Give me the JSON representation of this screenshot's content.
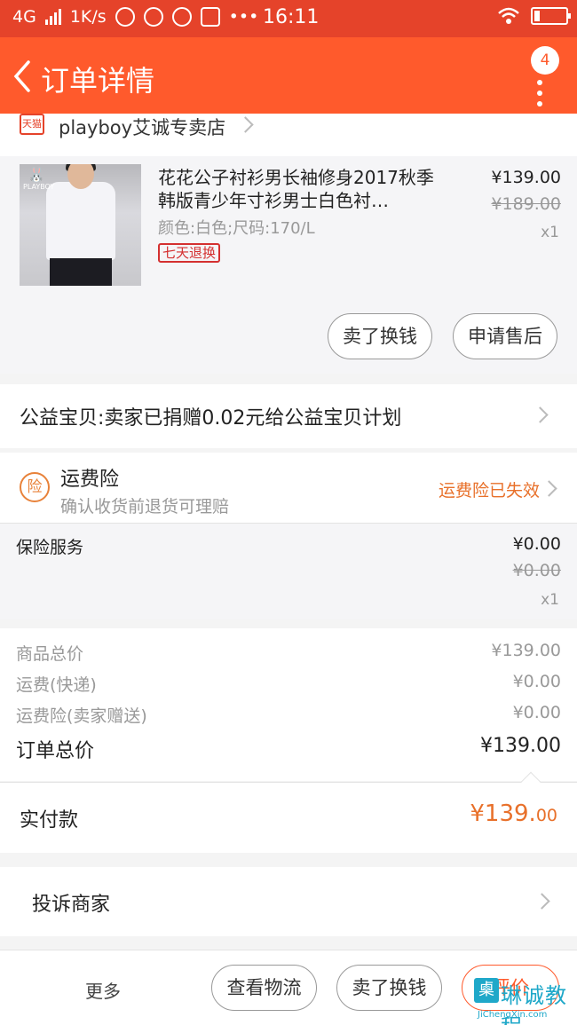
{
  "status_bar": {
    "network": "4G",
    "speed": "1K/s",
    "time": "16:11",
    "icons": [
      "signal-icon",
      "mail-icon",
      "weibo-icon",
      "qq-icon",
      "alipay-icon",
      "more-icon",
      "wifi-icon",
      "battery-icon"
    ]
  },
  "nav": {
    "title": "订单详情",
    "badge_count": "4"
  },
  "shop": {
    "platform_badge": "天猫",
    "name": "playboy艾诚专卖店"
  },
  "item": {
    "brand_logo": "PLAYBOY",
    "title": "花花公子衬衫男长袖修身2017秋季韩版青少年寸衫男士白色衬…",
    "spec": "颜色:白色;尺码:170/L",
    "tag": "七天退换",
    "price": "¥139.00",
    "original_price": "¥189.00",
    "quantity": "x1",
    "buttons": {
      "resell": "卖了换钱",
      "after_sale": "申请售后"
    }
  },
  "charity": {
    "text": "公益宝贝:卖家已捐赠0.02元给公益宝贝计划"
  },
  "shipping_insurance": {
    "icon_char": "险",
    "title": "运费险",
    "subtitle": "确认收货前退货可理赔",
    "status": "运费险已失效"
  },
  "insurance_service": {
    "label": "保险服务",
    "price": "¥0.00",
    "original_price": "¥0.00",
    "quantity": "x1"
  },
  "summary": {
    "goods_label": "商品总价",
    "goods_value": "¥139.00",
    "shipping_label": "运费(快递)",
    "shipping_value": "¥0.00",
    "ins_label": "运费险(卖家赠送)",
    "ins_value": "¥0.00",
    "total_label": "订单总价",
    "total_value": "¥139.00"
  },
  "paid": {
    "label": "实付款",
    "amount_main": "¥139.",
    "amount_decimal": "00"
  },
  "complain": {
    "label": "投诉商家"
  },
  "bottom_bar": {
    "more": "更多",
    "logistics": "查看物流",
    "resell": "卖了换钱",
    "review": "评价"
  },
  "watermark": {
    "char": "㮚",
    "cn": "琳诚教程",
    "en": "JiChengXin.com"
  },
  "colors": {
    "accent": "#ff5a2c",
    "status_bar": "#e5432a",
    "orange_text": "#e8702a",
    "tag_red": "#d43030"
  }
}
